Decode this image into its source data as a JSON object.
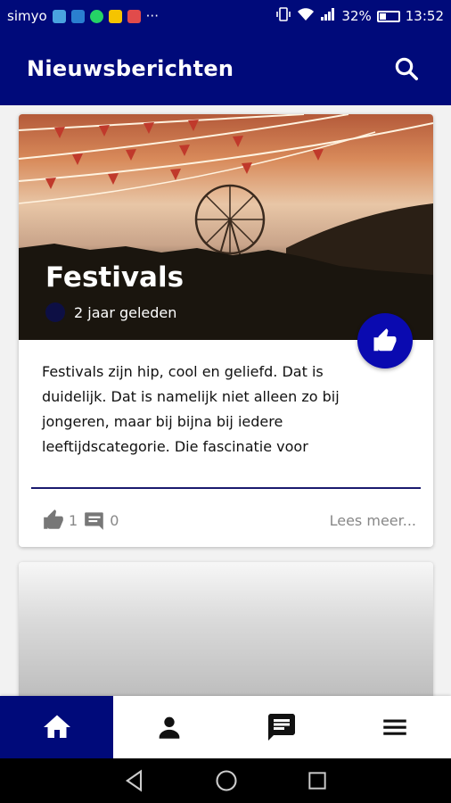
{
  "status_bar": {
    "carrier": "simyo",
    "more": "···",
    "battery": "32%",
    "time": "13:52"
  },
  "app_bar": {
    "title": "Nieuwsberichten"
  },
  "article": {
    "title": "Festivals",
    "time_ago": "2 jaar geleden",
    "excerpt": "Festivals zijn hip, cool en geliefd. Dat is duidelijk. Dat is namelijk niet alleen zo bij jongeren, maar bij bijna bij iedere leeftijdscategorie. Die fascinatie voor",
    "likes": "1",
    "comments": "0",
    "read_more": "Lees meer..."
  },
  "colors": {
    "primary": "#000a7a",
    "accent": "#0a0ab0"
  },
  "bottom_nav": {
    "items": [
      "home-icon",
      "profile-icon",
      "chat-icon",
      "menu-icon"
    ],
    "active": "home-icon"
  }
}
